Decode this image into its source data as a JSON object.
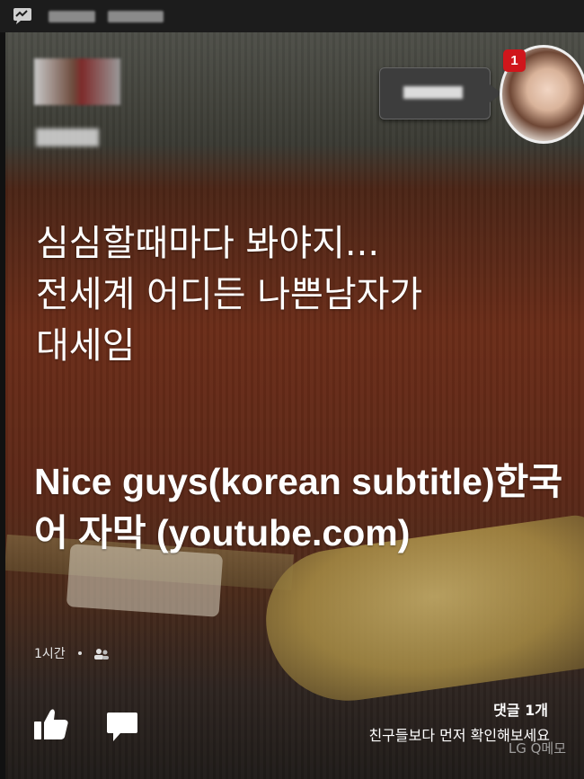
{
  "post": {
    "message": "심심할때마다 봐야지...\n전세계 어디든 나쁜남자가\n대세임",
    "link_title": "Nice guys(korean subtitle)한국어 자막 (youtube.com)",
    "time": "1시간",
    "privacy_icon": "friends-icon"
  },
  "notifications": {
    "badge_count": "1"
  },
  "actions": {
    "like_icon": "thumbs-up-icon",
    "comment_icon": "comment-bubble-icon",
    "comment_count": "댓글 1개",
    "comment_prompt": "친구들보다 먼저 확인해보세요"
  },
  "watermark": "LG Q메모",
  "colors": {
    "badge": "#d0161b",
    "text": "#ffffff"
  }
}
